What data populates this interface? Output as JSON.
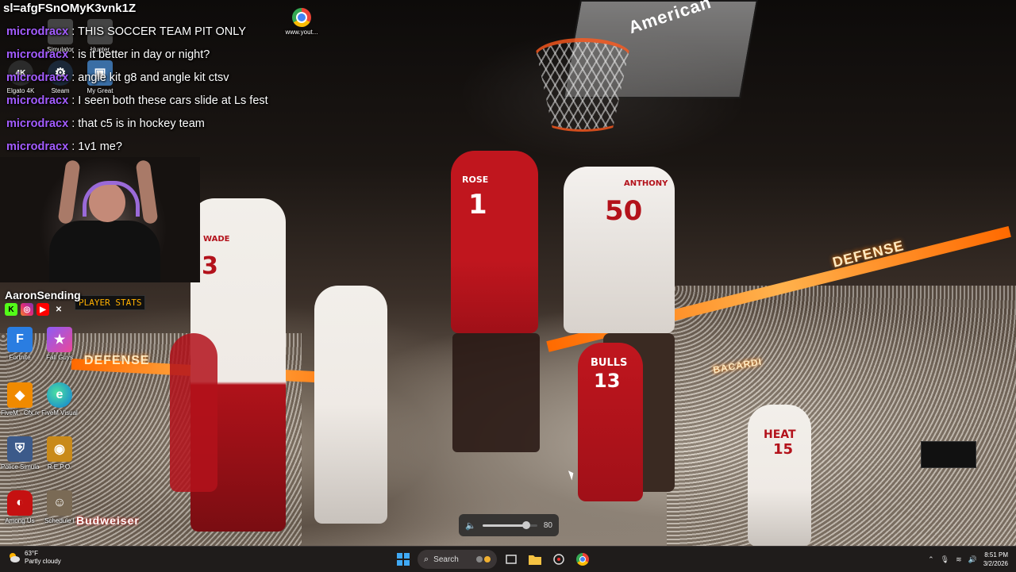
{
  "overlay": {
    "title": "sl=afgFSnOMyK3vnk1Z",
    "chat": [
      {
        "user": "microdracx",
        "message": "THIS SOCCER TEAM PIT ONLY"
      },
      {
        "user": "microdracx",
        "message": "is it better in day or night?"
      },
      {
        "user": "microdracx",
        "message": "angle kit g8 and angle kit ctsv"
      },
      {
        "user": "microdracx",
        "message": "I seen both these cars slide at Ls fest"
      },
      {
        "user": "microdracx",
        "message": "that c5 is in hockey team"
      },
      {
        "user": "microdracx",
        "message": "1v1 me?"
      }
    ],
    "social_name": "AaronSending",
    "social_icons": [
      "kick-icon",
      "instagram-icon",
      "youtube-icon",
      "x-icon"
    ]
  },
  "desktop_icons": [
    {
      "label": "www.yout...",
      "icon": "chrome-icon",
      "color": "#ffffff"
    },
    {
      "label": "Simulator",
      "icon": "app-icon",
      "color": "#444444"
    },
    {
      "label": "Hunter",
      "icon": "app-icon",
      "color": "#444444"
    },
    {
      "label": "Elgato 4K",
      "icon": "elgato-icon",
      "color": "#2b2b2b"
    },
    {
      "label": "Steam",
      "icon": "steam-icon",
      "color": "#1b2838"
    },
    {
      "label": "My Great",
      "icon": "app-icon",
      "color": "#3a6ea5"
    },
    {
      "label": "Fortnite",
      "icon": "fortnite-icon",
      "color": "#2a7de1"
    },
    {
      "label": "Fall Guys",
      "icon": "fallguys-icon",
      "color": "#8b5cf6"
    },
    {
      "label": "FiveM - Cfx.re Devel...",
      "icon": "fivem-icon",
      "color": "#f08a00"
    },
    {
      "label": "FiveM Visual",
      "icon": "edge-icon",
      "color": "#0f7bd8"
    },
    {
      "label": "Police Simulat...",
      "icon": "police-icon",
      "color": "#3c5a8a"
    },
    {
      "label": "R.E.P.O.",
      "icon": "repo-icon",
      "color": "#c98a1a"
    },
    {
      "label": "Among Us",
      "icon": "amongus-icon",
      "color": "#c51111"
    },
    {
      "label": "Schedule I",
      "icon": "schedule-icon",
      "color": "#7a6a55"
    }
  ],
  "scene_text": {
    "jersey_rose": "1",
    "jersey_anthony": "50",
    "jersey_bulls": "13",
    "jersey_heat": "15",
    "banner_defense_1": "DEFENSE",
    "banner_defense_2": "DEFENSE",
    "bacardi": "BACARDI",
    "budweiser": "Budweiser",
    "american": "American",
    "player_stats": "PLAYER STATS",
    "heat_word": "HEAT",
    "bulls_word": "BULLS",
    "anthony_name": "ANTHONY",
    "rose_name": "ROSE",
    "wade_name": "WADE"
  },
  "volume": {
    "value": "80",
    "level": 0.8
  },
  "taskbar": {
    "weather_temp": "63°F",
    "weather_desc": "Partly cloudy",
    "search_label": "Search",
    "time": "8:51 PM",
    "date": "3/2/2026"
  }
}
